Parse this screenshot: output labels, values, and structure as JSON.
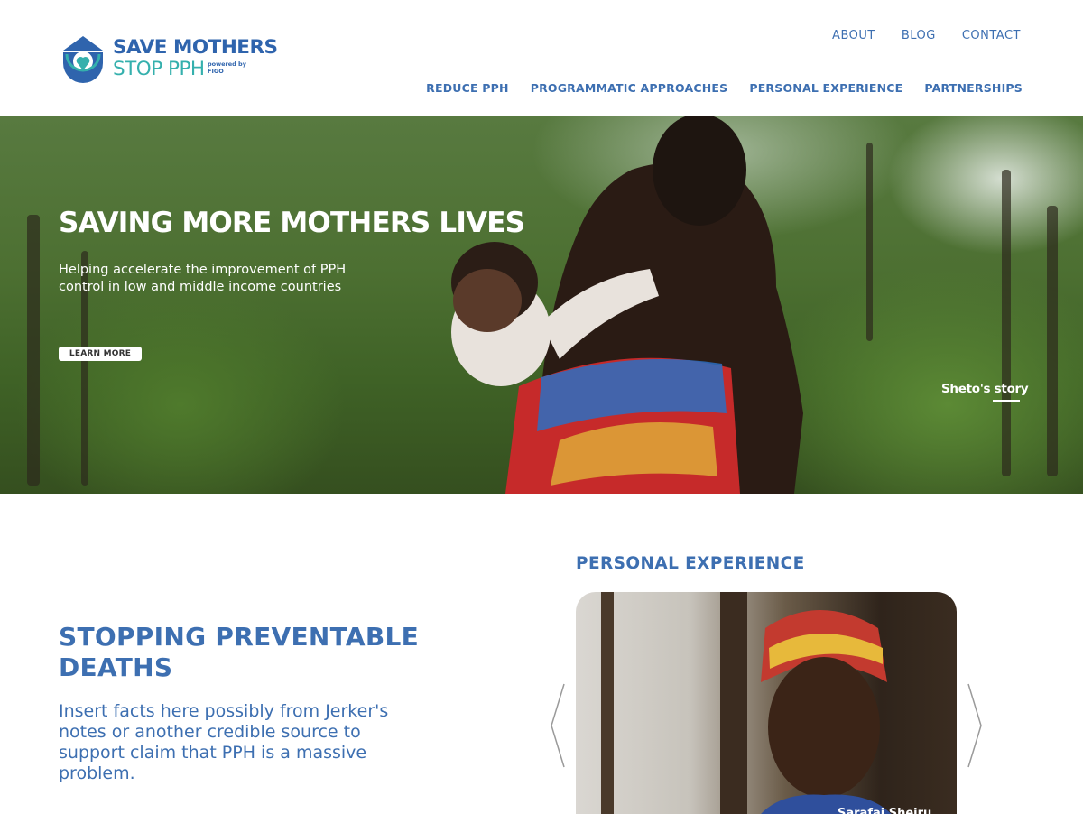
{
  "header": {
    "logo": {
      "line1": "SAVE MOTHERS",
      "line2": "STOP PPH",
      "powered_line1": "powered by",
      "powered_line2": "FIGO",
      "brand_blue": "#2f64ad",
      "brand_teal": "#35b0ad"
    },
    "top_nav": [
      {
        "label": "ABOUT"
      },
      {
        "label": "BLOG"
      },
      {
        "label": "CONTACT"
      }
    ],
    "main_nav": [
      {
        "label": "REDUCE PPH"
      },
      {
        "label": "PROGRAMMATIC APPROACHES"
      },
      {
        "label": "PERSONAL EXPERIENCE"
      },
      {
        "label": "PARTNERSHIPS"
      }
    ]
  },
  "hero": {
    "title": "SAVING MORE MOTHERS LIVES",
    "subtitle": "Helping accelerate the improvement of PPH control in low and middle income countries",
    "button_label": "LEARN MORE",
    "story_link": "Sheto's story"
  },
  "intro": {
    "title": "STOPPING PREVENTABLE DEATHS",
    "body": "Insert facts here possibly from Jerker's notes or another credible source to support claim that PPH is a massive problem."
  },
  "personal_experience": {
    "title": "PERSONAL EXPERIENCE",
    "card_caption": "Sarafai Sheiru",
    "prev_icon": "chevron-left-icon",
    "next_icon": "chevron-right-icon"
  },
  "colors": {
    "accent": "#3d6fb1",
    "white": "#ffffff"
  }
}
